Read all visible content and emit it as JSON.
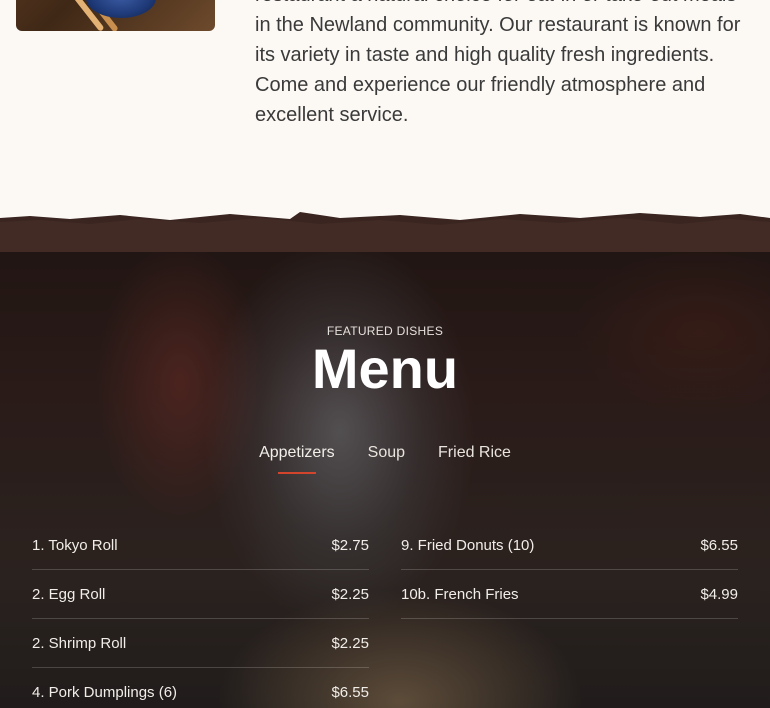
{
  "about": {
    "text": "restaurant a natural choice for eat-in or take-out meals in the Newland community. Our restaurant is known for its variety in taste and high quality fresh ingredients. Come and experience our friendly atmosphere and excellent service."
  },
  "menu": {
    "eyebrow": "FEATURED DISHES",
    "title": "Menu",
    "tabs": [
      {
        "label": "Appetizers",
        "active": true
      },
      {
        "label": "Soup",
        "active": false
      },
      {
        "label": "Fried Rice",
        "active": false
      }
    ],
    "left_items": [
      {
        "name": "1. Tokyo Roll",
        "price": "$2.75"
      },
      {
        "name": "2. Egg Roll",
        "price": "$2.25"
      },
      {
        "name": "2. Shrimp Roll",
        "price": "$2.25"
      },
      {
        "name": "4. Pork Dumplings (6)",
        "price": "$6.55"
      }
    ],
    "right_items": [
      {
        "name": "9. Fried Donuts (10)",
        "price": "$6.55"
      },
      {
        "name": "10b. French Fries",
        "price": "$4.99"
      }
    ]
  },
  "colors": {
    "accent": "#d2442c",
    "page_bg": "#fcf9f5"
  }
}
